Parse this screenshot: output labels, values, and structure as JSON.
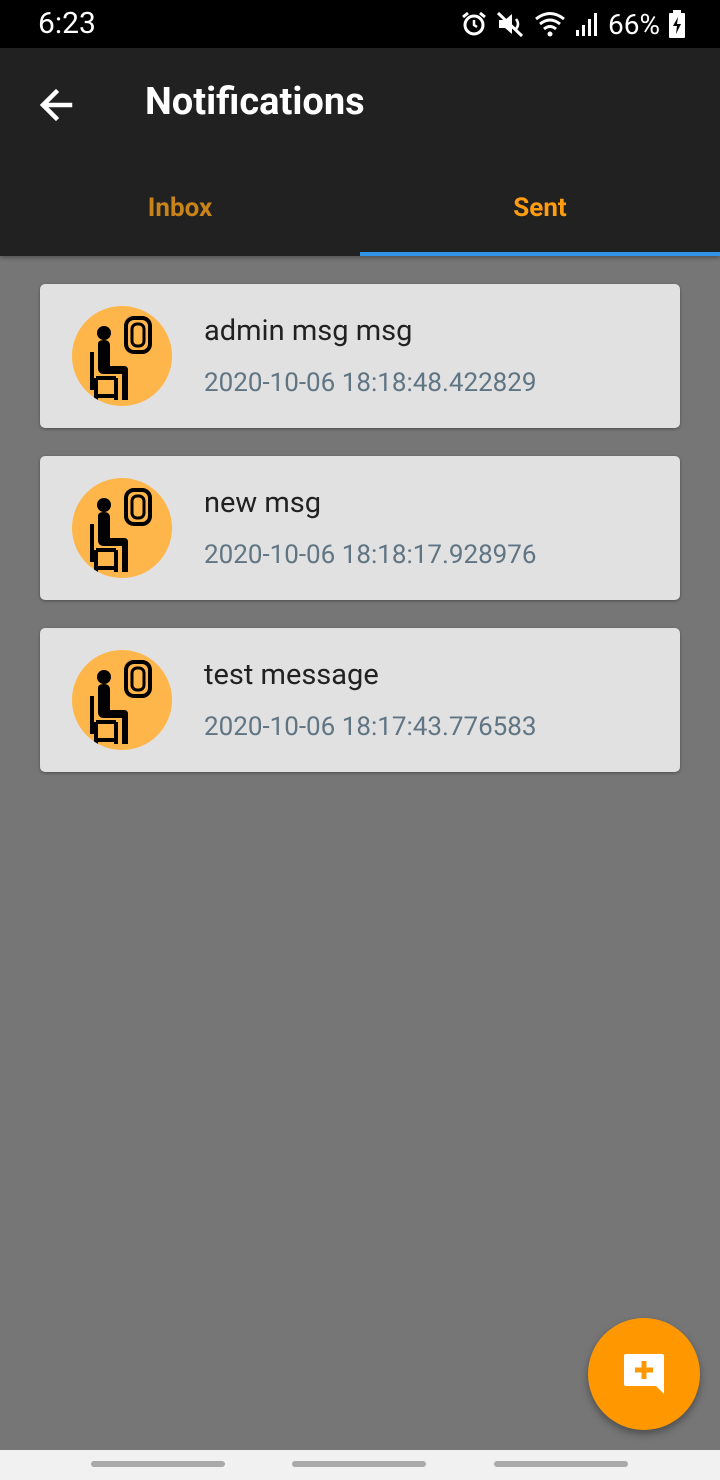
{
  "status": {
    "time": "6:23",
    "battery": "66%"
  },
  "appbar": {
    "title": "Notifications"
  },
  "tabs": [
    {
      "label": "Inbox"
    },
    {
      "label": "Sent"
    }
  ],
  "selected_tab": "Sent",
  "messages": [
    {
      "title": "admin msg msg",
      "timestamp": "2020-10-06 18:18:48.422829",
      "icon": "passenger-window-icon"
    },
    {
      "title": "new msg",
      "timestamp": "2020-10-06 18:18:17.928976",
      "icon": "passenger-window-icon"
    },
    {
      "title": "test message",
      "timestamp": "2020-10-06 18:17:43.776583",
      "icon": "passenger-window-icon"
    }
  ],
  "fab": {
    "icon": "add-comment-icon"
  },
  "colors": {
    "accent": "#FF9800",
    "tab_indicator": "#2F94E8",
    "appbar": "#212121",
    "avatar_bg": "#FEB549",
    "background": "#767676",
    "timestamp": "#607584"
  }
}
